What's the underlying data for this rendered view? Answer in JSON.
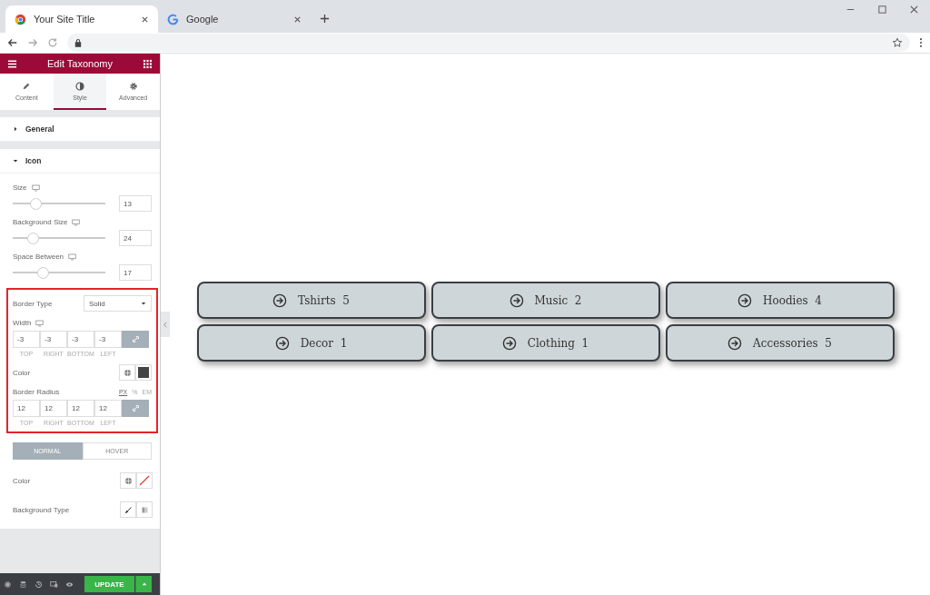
{
  "browser": {
    "tabs": [
      {
        "title": "Your Site Title",
        "selected": true
      },
      {
        "title": "Google",
        "selected": false
      }
    ]
  },
  "panel": {
    "title": "Edit Taxonomy",
    "tabs": [
      {
        "label": "Content",
        "selected": false
      },
      {
        "label": "Style",
        "selected": true
      },
      {
        "label": "Advanced",
        "selected": false
      }
    ],
    "sections": [
      {
        "title": "General",
        "expanded": false
      },
      {
        "title": "Icon",
        "expanded": true
      }
    ],
    "sliders": [
      {
        "label": "Size",
        "level": 0.25,
        "value": "13"
      },
      {
        "label": "Background Size",
        "level": 0.23,
        "value": "24"
      },
      {
        "label": "Space Between",
        "level": 0.33,
        "value": "17"
      }
    ],
    "border_type": {
      "label": "Border Type",
      "value": "Solid"
    },
    "width": {
      "label": "Width",
      "values": [
        "-3",
        "-3",
        "-3",
        "-3"
      ],
      "sides": [
        "TOP",
        "RIGHT",
        "BOTTOM",
        "LEFT"
      ],
      "linked": true
    },
    "border_color": {
      "label": "Color",
      "color": "#444444"
    },
    "border_radius": {
      "label": "Border Radius",
      "units": [
        {
          "label": "PX",
          "selected": true
        },
        {
          "label": "%",
          "selected": false
        },
        {
          "label": "EM",
          "selected": false
        }
      ],
      "values": [
        "12",
        "12",
        "12",
        "12"
      ],
      "sides": [
        "TOP",
        "RIGHT",
        "BOTTOM",
        "LEFT"
      ],
      "linked": true
    },
    "state_tabs": [
      {
        "label": "NORMAL",
        "selected": true
      },
      {
        "label": "HOVER",
        "selected": false
      }
    ],
    "icon_color": {
      "label": "Color"
    },
    "background_type": {
      "label": "Background Type"
    },
    "update_label": "UPDATE"
  },
  "terms": [
    {
      "label": "Tshirts  5"
    },
    {
      "label": "Music  2"
    },
    {
      "label": "Hoodies  4"
    },
    {
      "label": "Decor  1"
    },
    {
      "label": "Clothing  1"
    },
    {
      "label": "Accessories  5"
    }
  ]
}
